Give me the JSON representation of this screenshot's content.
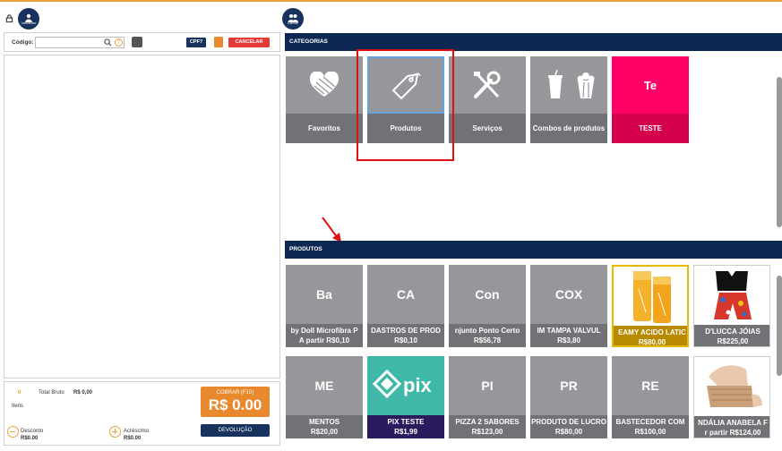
{
  "header": {
    "vendor_label": "Vendedor",
    "client_label": "Cliente"
  },
  "toolbar": {
    "codigo_label": "Código:",
    "help_label": "?",
    "cpf_label": "CPF?",
    "cancel_label": "CANCELAR"
  },
  "totals": {
    "items_count": "0",
    "items_label": "Itens",
    "gross_label": "Total Bruto",
    "gross_value": "R$ 0,00",
    "discount_label": "Desconto",
    "discount_value": "R$0.00",
    "addition_label": "Acréscimo",
    "addition_value": "R$0.00",
    "charge_label": "COBRAR (F10)",
    "charge_value": "R$ 0.00",
    "return_label": "DEVOLUÇÃO"
  },
  "categories": {
    "header": "CATEGORIAS",
    "items": [
      {
        "label": "Favoritos",
        "icon": "heart-icon"
      },
      {
        "label": "Produtos",
        "icon": "tag-icon"
      },
      {
        "label": "Serviços",
        "icon": "tools-icon"
      },
      {
        "label": "Combos de produtos",
        "icon": "combo-icon"
      },
      {
        "label": "TESTE",
        "abbr": "Te",
        "color": "#ff0066",
        "bottom_color": "#d4004e"
      }
    ]
  },
  "products": {
    "header": "PRODUTOS",
    "row1": [
      {
        "abbr": "Ba",
        "name": "by Doll Microfibra P",
        "price": "A partir   R$0,10"
      },
      {
        "abbr": "CA",
        "name": "DASTROS DE PROD",
        "price": "R$0,10"
      },
      {
        "abbr": "Con",
        "name": "njunto Ponto Certo",
        "price": "R$56,78"
      },
      {
        "abbr": "COX",
        "name": "IM TAMPA VALVUL",
        "price": "R$3,80"
      },
      {
        "abbr": "",
        "name": "EAMY ACIDO LATIC",
        "price": "R$80,00",
        "image": "cream-bottles"
      },
      {
        "abbr": "",
        "name": "D'LUCCA JÓIAS",
        "price": "R$225,00",
        "image": "clothing"
      }
    ],
    "row2": [
      {
        "abbr": "ME",
        "name": "MENTOS",
        "price": "R$20,00"
      },
      {
        "abbr": "",
        "name": "PIX TESTE",
        "price": "R$1,99",
        "image": "pix",
        "bottom_color": "#2b1a5e"
      },
      {
        "abbr": "PI",
        "name": "PIZZA 2 SABORES",
        "price": "R$123,00"
      },
      {
        "abbr": "PR",
        "name": "PRODUTO DE LUCRO",
        "price": "R$80,00"
      },
      {
        "abbr": "RE",
        "name": "BASTECEDOR COM",
        "price": "R$100,00"
      },
      {
        "abbr": "",
        "name": "NDÁLIA ANABELA F",
        "price": "r partir   R$124,00",
        "image": "sandal"
      }
    ]
  },
  "colors": {
    "navy": "#0c2751",
    "orange": "#e8892e",
    "red": "#e53935",
    "tile": "#95979a",
    "tile_bottom": "#707275",
    "highlight": "#e01010"
  }
}
